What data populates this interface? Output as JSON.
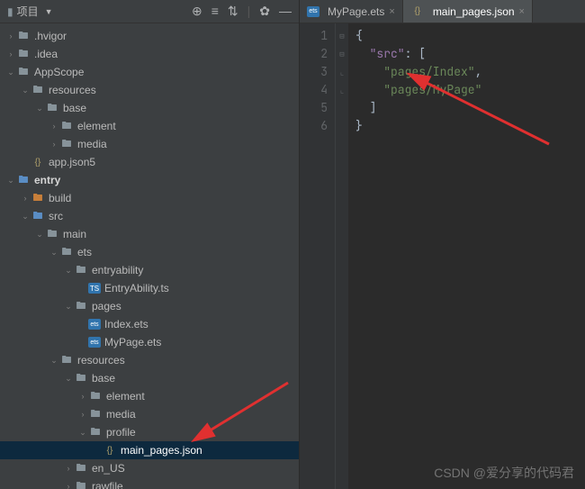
{
  "sidebar": {
    "title": "项目",
    "toolbar_icons": [
      "target-icon",
      "collapse-all-icon",
      "expand-all-icon",
      "divider",
      "settings-icon",
      "hide-icon"
    ]
  },
  "tree": [
    {
      "depth": 0,
      "exp": ">",
      "icon": "folder",
      "name": ".hvigor"
    },
    {
      "depth": 0,
      "exp": ">",
      "icon": "folder",
      "name": ".idea"
    },
    {
      "depth": 0,
      "exp": "v",
      "icon": "folder",
      "name": "AppScope"
    },
    {
      "depth": 1,
      "exp": "v",
      "icon": "folder",
      "name": "resources"
    },
    {
      "depth": 2,
      "exp": "v",
      "icon": "folder",
      "name": "base"
    },
    {
      "depth": 3,
      "exp": ">",
      "icon": "folder",
      "name": "element"
    },
    {
      "depth": 3,
      "exp": ">",
      "icon": "folder",
      "name": "media"
    },
    {
      "depth": 1,
      "exp": "",
      "icon": "file-json",
      "name": "app.json5"
    },
    {
      "depth": 0,
      "exp": "v",
      "icon": "folder blue",
      "name": "entry",
      "bold": true
    },
    {
      "depth": 1,
      "exp": ">",
      "icon": "folder orange",
      "name": "build"
    },
    {
      "depth": 1,
      "exp": "v",
      "icon": "folder blue",
      "name": "src"
    },
    {
      "depth": 2,
      "exp": "v",
      "icon": "folder",
      "name": "main"
    },
    {
      "depth": 3,
      "exp": "v",
      "icon": "folder",
      "name": "ets"
    },
    {
      "depth": 4,
      "exp": "v",
      "icon": "folder",
      "name": "entryability"
    },
    {
      "depth": 5,
      "exp": "",
      "icon": "file-ts",
      "name": "EntryAbility.ts"
    },
    {
      "depth": 4,
      "exp": "v",
      "icon": "folder",
      "name": "pages"
    },
    {
      "depth": 5,
      "exp": "",
      "icon": "file-ets",
      "name": "Index.ets"
    },
    {
      "depth": 5,
      "exp": "",
      "icon": "file-ets",
      "name": "MyPage.ets"
    },
    {
      "depth": 3,
      "exp": "v",
      "icon": "folder",
      "name": "resources"
    },
    {
      "depth": 4,
      "exp": "v",
      "icon": "folder",
      "name": "base"
    },
    {
      "depth": 5,
      "exp": ">",
      "icon": "folder",
      "name": "element"
    },
    {
      "depth": 5,
      "exp": ">",
      "icon": "folder",
      "name": "media"
    },
    {
      "depth": 5,
      "exp": "v",
      "icon": "folder",
      "name": "profile"
    },
    {
      "depth": 6,
      "exp": "",
      "icon": "file-json",
      "name": "main_pages.json",
      "selected": true
    },
    {
      "depth": 4,
      "exp": ">",
      "icon": "folder",
      "name": "en_US"
    },
    {
      "depth": 4,
      "exp": ">",
      "icon": "folder",
      "name": "rawfile"
    }
  ],
  "tabs": [
    {
      "icon": "file-ets",
      "label": "MyPage.ets",
      "active": false
    },
    {
      "icon": "file-json",
      "label": "main_pages.json",
      "active": true
    }
  ],
  "code": {
    "lines": [
      "1",
      "2",
      "3",
      "4",
      "5",
      "6"
    ],
    "content": {
      "open_brace": "{",
      "key_src": "\"src\"",
      "colon": ": ",
      "open_bracket": "[",
      "val1": "\"pages/Index\"",
      "comma": ",",
      "val2": "\"pages/MyPage\"",
      "close_bracket": "]",
      "close_brace": "}"
    }
  },
  "watermark": "CSDN @爱分享的代码君"
}
